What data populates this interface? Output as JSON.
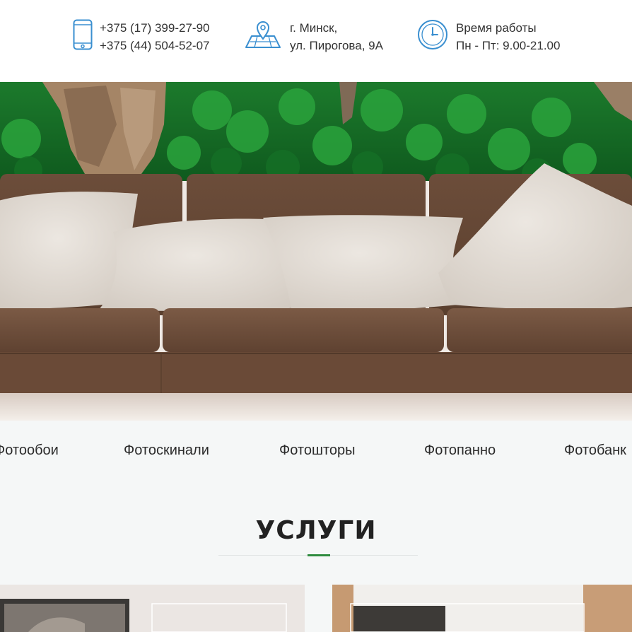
{
  "header": {
    "phones": [
      "+375 (17) 399-27-90",
      "+375 (44) 504-52-07"
    ],
    "address": [
      "г. Минск,",
      "ул. Пирогова, 9А"
    ],
    "hours": [
      "Время работы",
      "Пн - Пт: 9.00-21.00"
    ],
    "icons": {
      "phone": "smartphone-icon",
      "address": "map-pin-icon",
      "hours": "clock-icon"
    },
    "icon_color": "#3a8fd0"
  },
  "categories": [
    "Фотообои",
    "Фотоскинали",
    "Фотошторы",
    "Фотопанно",
    "Фотобанк"
  ],
  "services": {
    "title": "УСЛУГИ",
    "accent_color": "#2e8b3e"
  }
}
